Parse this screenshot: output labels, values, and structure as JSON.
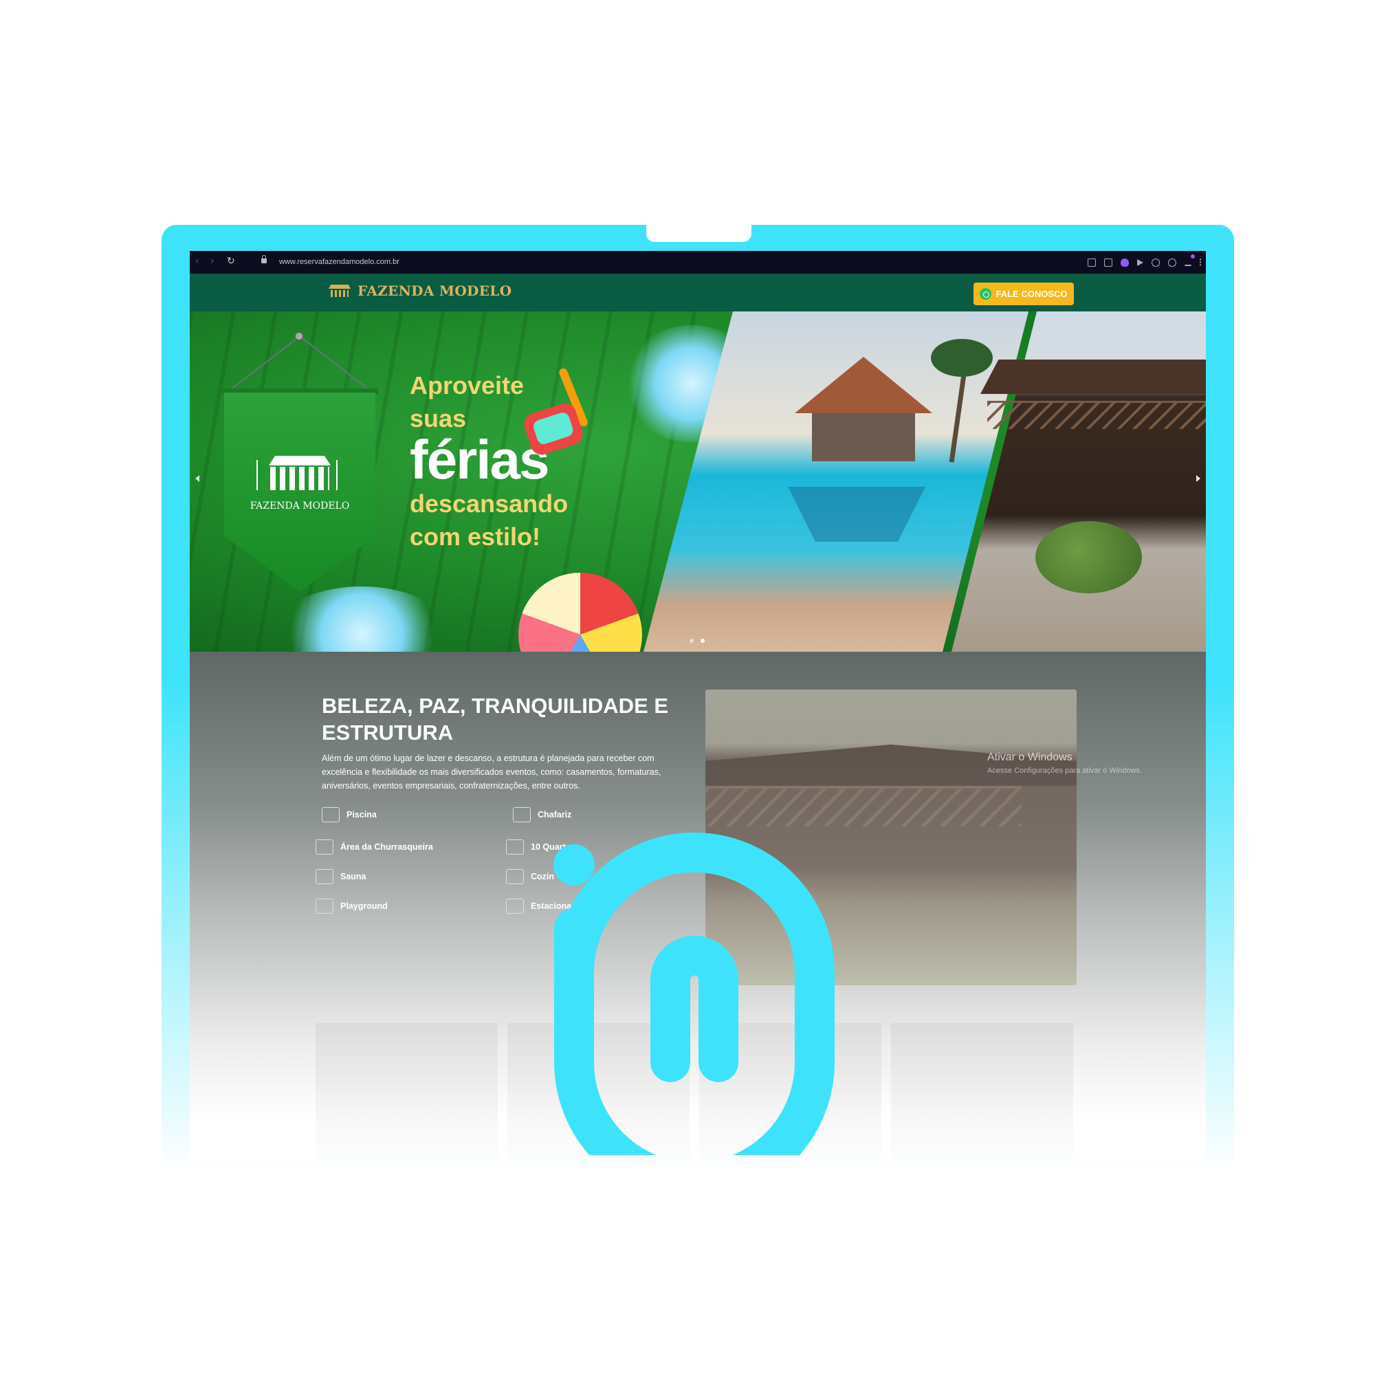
{
  "browser": {
    "url": "www.reservafazendamodelo.com.br"
  },
  "header": {
    "logo_text": "FAZENDA MODELO",
    "cta_label": "FALE CONOSCO"
  },
  "hero": {
    "pennant_text": "FAZENDA MODELO",
    "tagline": [
      "Aproveite",
      "suas",
      "férias",
      "descansando",
      "com estilo!"
    ],
    "slides_total": 2,
    "active_slide": 2
  },
  "section": {
    "title": "BELEZA, PAZ, TRANQUILIDADE E ESTRUTURA",
    "text": "Além de um ótimo lugar de lazer e descanso, a estrutura é planejada para receber com excelência e flexibilidade os mais diversificados eventos, como: casamentos, formaturas, aniversários, eventos empresariais, confraternizações, entre outros.",
    "features": [
      {
        "label": "Piscina",
        "icon": "pool-icon"
      },
      {
        "label": "Chafariz",
        "icon": "fountain-icon"
      },
      {
        "label": "Área da Churrasqueira",
        "icon": "grill-icon"
      },
      {
        "label": "10 Quartos",
        "icon": "bed-icon"
      },
      {
        "label": "Sauna",
        "icon": "sauna-icon"
      },
      {
        "label": "Cozin",
        "icon": "kitchen-icon"
      },
      {
        "label": "Playground",
        "icon": "playground-icon"
      },
      {
        "label": "Estacionamento",
        "icon": "parking-icon"
      }
    ],
    "watermark_title": "Ativar o Windows",
    "watermark_sub": "Acesse Configurações para ativar o Windows."
  },
  "colors": {
    "frame": "#3ee3fb",
    "header_bg": "#0a5c43",
    "logo_gold": "#d9b461",
    "cta": "#f6b81c",
    "hero_green": "#1f8a2a",
    "brand_mark": "#3ee3fb"
  }
}
